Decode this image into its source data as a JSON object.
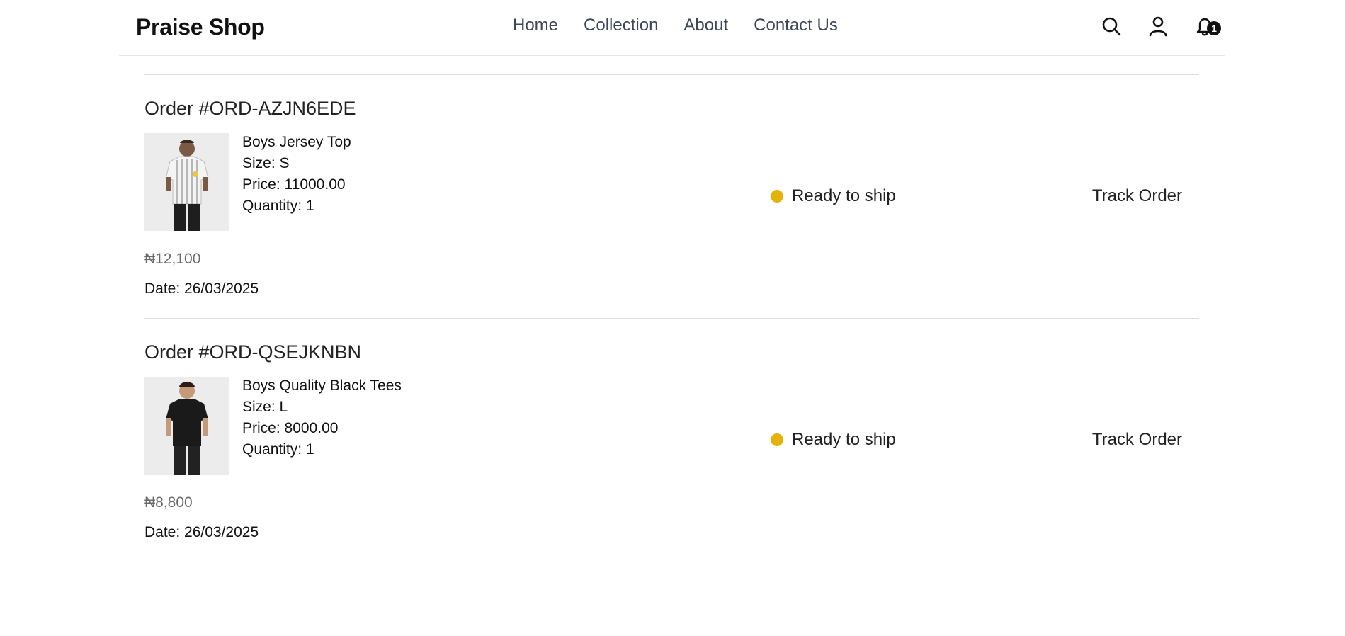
{
  "header": {
    "brand": "Praise Shop",
    "nav": [
      "Home",
      "Collection",
      "About",
      "Contact Us"
    ],
    "notification_count": "1",
    "icons": [
      "search-icon",
      "user-icon",
      "bell-icon"
    ]
  },
  "colors": {
    "status_dot": "#e5b20c",
    "nav_text": "#3f4656"
  },
  "orders": [
    {
      "title": "Order #ORD-AZJN6EDE",
      "product_name": "Boys Jersey Top",
      "size_label": "Size: ",
      "size": "S",
      "price_label": "Price: ",
      "price": "11000.00",
      "quantity_label": "Quantity: ",
      "quantity": "1",
      "status": "Ready to ship",
      "track_label": "Track Order",
      "total": "₦12,100",
      "date_label": "Date: ",
      "date": "26/03/2025"
    },
    {
      "title": "Order #ORD-QSEJKNBN",
      "product_name": "Boys Quality Black Tees",
      "size_label": "Size: ",
      "size": "L",
      "price_label": "Price: ",
      "price": "8000.00",
      "quantity_label": "Quantity: ",
      "quantity": "1",
      "status": "Ready to ship",
      "track_label": "Track Order",
      "total": "₦8,800",
      "date_label": "Date: ",
      "date": "26/03/2025"
    }
  ]
}
